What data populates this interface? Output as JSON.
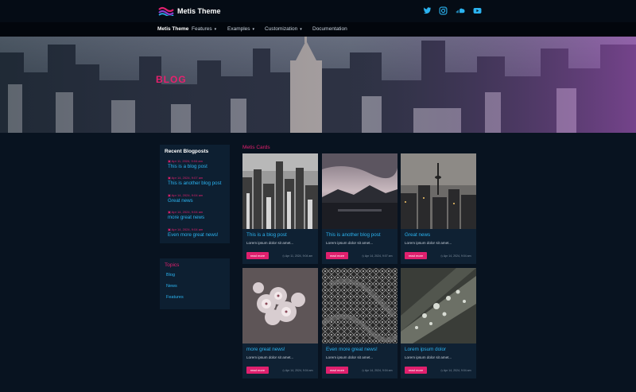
{
  "header": {
    "brand_name": "Metis Theme",
    "social_icons": [
      "twitter-icon",
      "instagram-icon",
      "soundcloud-icon",
      "youtube-icon"
    ]
  },
  "nav": {
    "items": [
      {
        "label": "Metis Theme",
        "dropdown": false
      },
      {
        "label": "Features",
        "dropdown": true
      },
      {
        "label": "Examples",
        "dropdown": true
      },
      {
        "label": "Customization",
        "dropdown": true
      },
      {
        "label": "Documentation",
        "dropdown": false
      }
    ],
    "caret": "▾"
  },
  "hero": {
    "title": "BLOG"
  },
  "sidebar": {
    "recent_title": "Recent Blogposts",
    "posts": [
      {
        "date": "Apr 11, 2024, 9:04 am",
        "title": "This is a blog post"
      },
      {
        "date": "Apr 14, 2024, 9:07 am",
        "title": "This is another blog post"
      },
      {
        "date": "Apr 14, 2024, 9:04 am",
        "title": "Great news"
      },
      {
        "date": "Apr 14, 2024, 9:04 am",
        "title": "more great news"
      },
      {
        "date": "Apr 14, 2024, 9:04 am",
        "title": "Even more great news!"
      }
    ],
    "topics_title": "Topics",
    "topics": [
      "Blog",
      "News",
      "Features"
    ]
  },
  "main": {
    "section_title": "Metis Cards",
    "cards": [
      {
        "title": "This is a blog post",
        "excerpt": "Lorem ipsum dolor sit amet...",
        "button": "read more",
        "date": "Apr 11, 2024, 9:04 am",
        "image": "city-skyline-bw"
      },
      {
        "title": "This is another blog post",
        "excerpt": "Lorem ipsum dolor sit amet...",
        "button": "read more",
        "date": "Apr 14, 2024, 9:07 am",
        "image": "coastal-dusk"
      },
      {
        "title": "Great news",
        "excerpt": "Lorem ipsum dolor sit amet...",
        "button": "read more",
        "date": "Apr 14, 2024, 9:04 am",
        "image": "city-tower-dusk"
      },
      {
        "title": "more great news!",
        "excerpt": "Lorem ipsum dolor sit amet...",
        "button": "read more",
        "date": "Apr 14, 2024, 9:04 am",
        "image": "cherry-blossom"
      },
      {
        "title": "Even more great news!",
        "excerpt": "Lorem ipsum dolor sit amet...",
        "button": "read more",
        "date": "Apr 14, 2024, 9:04 am",
        "image": "frost-texture"
      },
      {
        "title": "Lorem ipsum dolor",
        "excerpt": "Lorem ipsum dolor sit amet...",
        "button": "read more",
        "date": "Apr 14, 2024, 9:04 am",
        "image": "water-droplets-leaf"
      }
    ]
  },
  "colors": {
    "background": "#081320",
    "panel": "#0d1f31",
    "card": "#0f2133",
    "accent_pink": "#e0206e",
    "link_blue": "#2bb3f0"
  }
}
